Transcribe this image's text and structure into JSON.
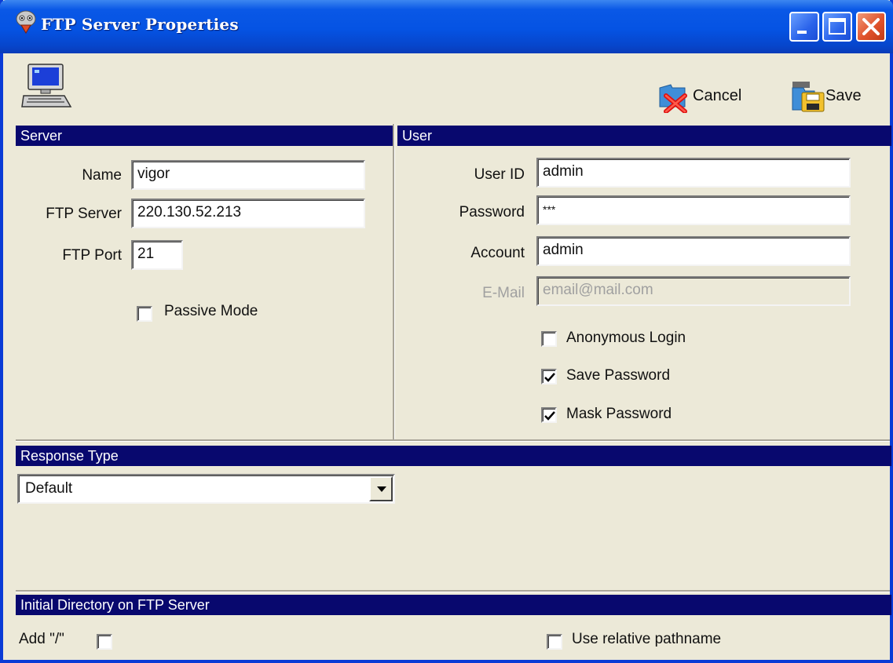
{
  "window": {
    "title": "FTP Server Properties",
    "controls": [
      "minimize-icon",
      "maximize-icon",
      "close-icon"
    ]
  },
  "toolbar": {
    "cancel_label": "Cancel",
    "save_label": "Save"
  },
  "server": {
    "header": "Server",
    "name_label": "Name",
    "name_value": "vigor",
    "ftp_server_label": "FTP Server",
    "ftp_server_value": "220.130.52.213",
    "ftp_port_label": "FTP Port",
    "ftp_port_value": "21",
    "passive_mode_label": "Passive Mode",
    "passive_mode_checked": false
  },
  "user": {
    "header": "User",
    "user_id_label": "User ID",
    "user_id_value": "admin",
    "password_label": "Password",
    "password_value": "***",
    "account_label": "Account",
    "account_value": "admin",
    "email_label": "E-Mail",
    "email_placeholder": "email@mail.com",
    "anonymous_login_label": "Anonymous Login",
    "anonymous_login_checked": false,
    "save_password_label": "Save Password",
    "save_password_checked": true,
    "mask_password_label": "Mask Password",
    "mask_password_checked": true
  },
  "response_type": {
    "header": "Response Type",
    "selected": "Default"
  },
  "initial_directory": {
    "header": "Initial Directory on FTP Server",
    "add_slash_label": "Add \"/\"",
    "add_slash_checked": false,
    "relative_path_label": "Use relative pathname",
    "relative_path_checked": false
  },
  "colors": {
    "section_header_bg": "#08086e",
    "window_bg": "#ece9d8",
    "titlebar_blue": "#0553e3"
  }
}
